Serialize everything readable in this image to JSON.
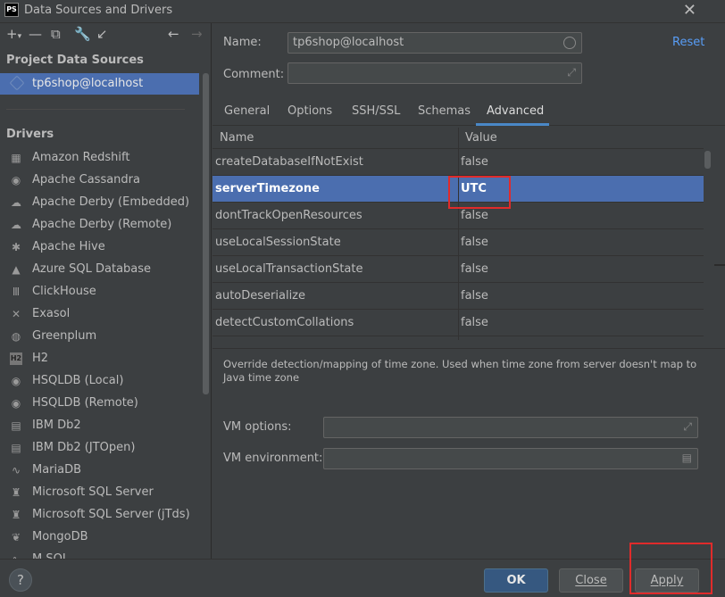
{
  "window": {
    "title": "Data Sources and Drivers",
    "app_icon": "PS"
  },
  "left": {
    "project_title": "Project Data Sources",
    "data_source": "tp6shop@localhost",
    "drivers_title": "Drivers",
    "drivers": [
      {
        "label": "Amazon Redshift",
        "icon": "▦"
      },
      {
        "label": "Apache Cassandra",
        "icon": "◉"
      },
      {
        "label": "Apache Derby (Embedded)",
        "icon": "☁"
      },
      {
        "label": "Apache Derby (Remote)",
        "icon": "☁"
      },
      {
        "label": "Apache Hive",
        "icon": "✱"
      },
      {
        "label": "Azure SQL Database",
        "icon": "▲"
      },
      {
        "label": "ClickHouse",
        "icon": "Ⅲ"
      },
      {
        "label": "Exasol",
        "icon": "✕"
      },
      {
        "label": "Greenplum",
        "icon": "◍"
      },
      {
        "label": "H2",
        "icon": "H2"
      },
      {
        "label": "HSQLDB (Local)",
        "icon": "◉"
      },
      {
        "label": "HSQLDB (Remote)",
        "icon": "◉"
      },
      {
        "label": "IBM Db2",
        "icon": "▤"
      },
      {
        "label": "IBM Db2 (JTOpen)",
        "icon": "▤"
      },
      {
        "label": "MariaDB",
        "icon": "∿"
      },
      {
        "label": "Microsoft SQL Server",
        "icon": "♜"
      },
      {
        "label": "Microsoft SQL Server (jTds)",
        "icon": "♜"
      },
      {
        "label": "MongoDB",
        "icon": "❦"
      },
      {
        "label": "M SQL",
        "icon": "∿"
      }
    ]
  },
  "form": {
    "name_label": "Name:",
    "name_value": "tp6shop@localhost",
    "comment_label": "Comment:",
    "comment_value": "",
    "reset_label": "Reset"
  },
  "tabs": [
    "General",
    "Options",
    "SSH/SSL",
    "Schemas",
    "Advanced"
  ],
  "table": {
    "headers": [
      "Name",
      "Value"
    ],
    "rows": [
      {
        "name": "createDatabaseIfNotExist",
        "value": "false"
      },
      {
        "name": "serverTimezone",
        "value": "UTC"
      },
      {
        "name": "dontTrackOpenResources",
        "value": "false"
      },
      {
        "name": "useLocalSessionState",
        "value": "false"
      },
      {
        "name": "useLocalTransactionState",
        "value": "false"
      },
      {
        "name": "autoDeserialize",
        "value": "false"
      },
      {
        "name": "detectCustomCollations",
        "value": "false"
      }
    ]
  },
  "description": "Override detection/mapping of time zone. Used when time zone from server doesn't map to Java time zone",
  "vm": {
    "options_label": "VM options:",
    "options_value": "",
    "env_label": "VM environment:",
    "env_value": ""
  },
  "buttons": {
    "help": "?",
    "ok": "OK",
    "close": "Close",
    "apply": "Apply"
  },
  "colors": {
    "selection": "#4b6eaf",
    "accent": "#589df6",
    "highlight": "#e02b2b"
  }
}
